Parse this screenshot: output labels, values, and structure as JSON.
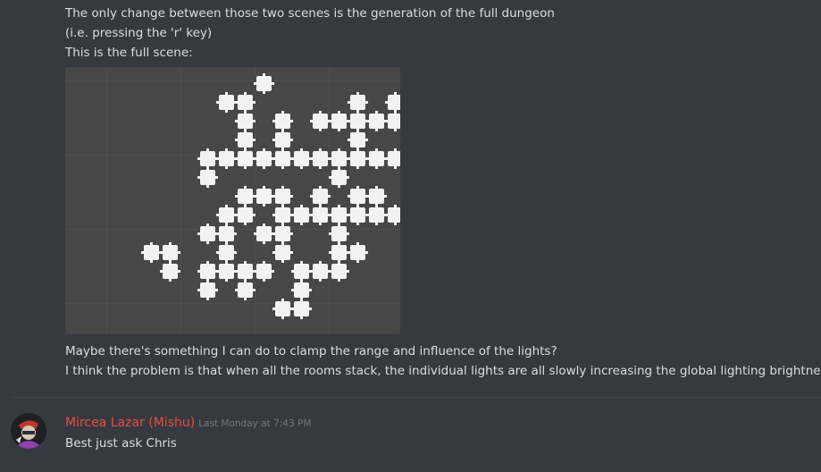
{
  "message1": {
    "lines": [
      "The only change between those two scenes is the generation of the full dungeon",
      "(i.e. pressing the 'r' key)",
      "This is the full scene:"
    ],
    "after_lines": [
      "Maybe there's something I can do to clamp the range and influence of the lights?",
      "I think the problem is that when all the rooms stack, the individual lights are all slowly increasing the global lighting brightness"
    ]
  },
  "message2": {
    "author": "Mircea Lazar (Mishu)",
    "timestamp": "Last Monday at 7:43 PM",
    "text": "Best just ask Chris",
    "author_color": "#e74c3c"
  },
  "colors": {
    "background": "#36393f",
    "text": "#dcddde",
    "muted": "#72767d",
    "attachment_bg": "#474747",
    "room": "#f2f2f2"
  },
  "attachment": {
    "type": "image",
    "description_icon": "dungeon-scene-image"
  }
}
